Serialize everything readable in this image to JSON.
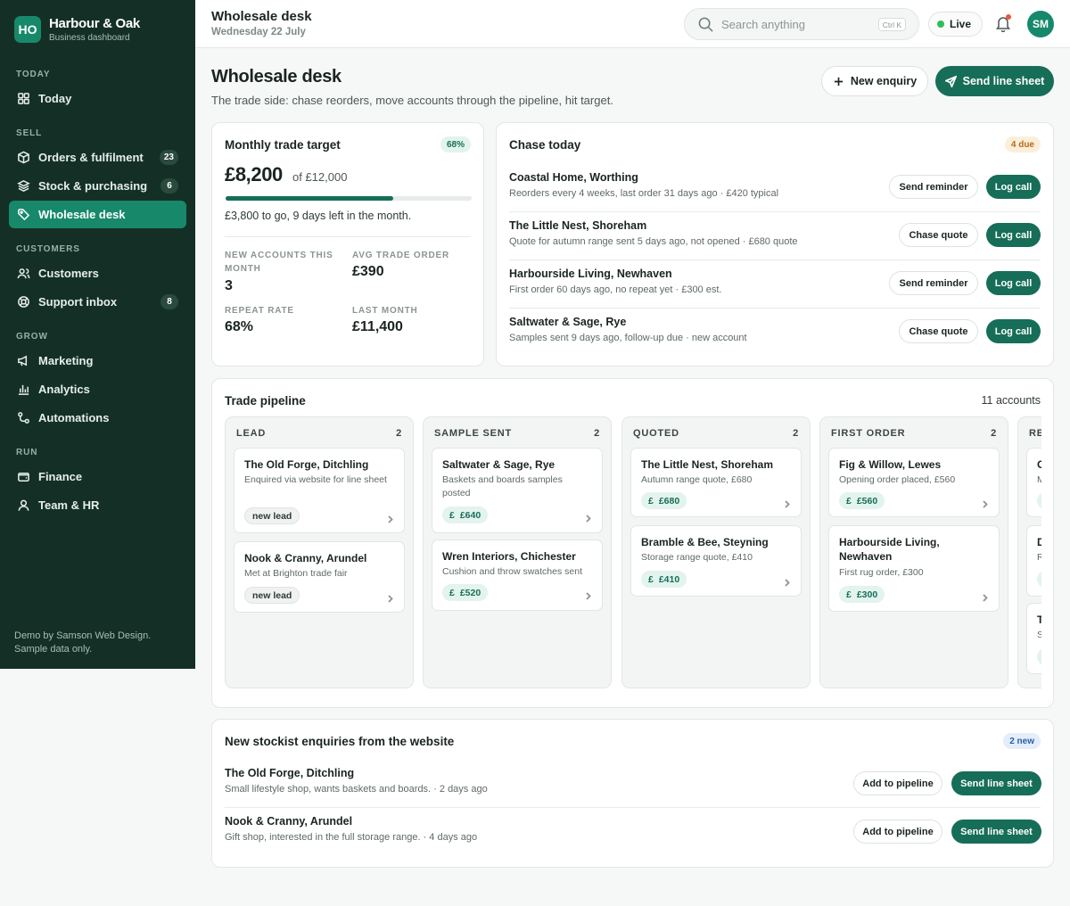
{
  "brand": {
    "initials": "HO",
    "name": "Harbour & Oak",
    "sub": "Business dashboard"
  },
  "nav": {
    "today_section": "TODAY",
    "today": "Today",
    "sell_section": "SELL",
    "orders": "Orders & fulfilment",
    "orders_badge": "23",
    "stock": "Stock & purchasing",
    "stock_badge": "6",
    "wholesale": "Wholesale desk",
    "customers_section": "CUSTOMERS",
    "customers": "Customers",
    "support": "Support inbox",
    "support_badge": "8",
    "grow_section": "GROW",
    "marketing": "Marketing",
    "analytics": "Analytics",
    "automations": "Automations",
    "run_section": "RUN",
    "finance": "Finance",
    "team": "Team & HR"
  },
  "footer": {
    "line1": "Demo by Samson Web Design.",
    "line2": "Sample data only."
  },
  "topbar": {
    "title": "Wholesale desk",
    "date": "Wednesday 22 July",
    "search_placeholder": "Search anything",
    "shortcut": "Ctrl K",
    "live": "Live",
    "avatar": "SM"
  },
  "page": {
    "title": "Wholesale desk",
    "subtitle": "The trade side: chase reorders, move accounts through the pipeline, hit target.",
    "new_enquiry": "New enquiry",
    "send_line_sheet": "Send line sheet"
  },
  "target": {
    "title": "Monthly trade target",
    "pct": "68%",
    "progress": 0.68,
    "amount": "£8,200",
    "of": "of £12,000",
    "togo": "£3,800 to go, 9 days left in the month.",
    "stats": [
      {
        "label": "NEW ACCOUNTS THIS MONTH",
        "value": "3"
      },
      {
        "label": "AVG TRADE ORDER",
        "value": "£390"
      },
      {
        "label": "REPEAT RATE",
        "value": "68%"
      },
      {
        "label": "LAST MONTH",
        "value": "£11,400"
      }
    ]
  },
  "chase": {
    "title": "Chase today",
    "due": "4 due",
    "rows": [
      {
        "name": "Coastal Home, Worthing",
        "desc": "Reorders every 4 weeks, last order 31 days ago · £420 typical",
        "action": "Send reminder",
        "log": "Log call"
      },
      {
        "name": "The Little Nest, Shoreham",
        "desc": "Quote for autumn range sent 5 days ago, not opened · £680 quote",
        "action": "Chase quote",
        "log": "Log call"
      },
      {
        "name": "Harbourside Living, Newhaven",
        "desc": "First order 60 days ago, no repeat yet · £300 est.",
        "action": "Send reminder",
        "log": "Log call"
      },
      {
        "name": "Saltwater & Sage, Rye",
        "desc": "Samples sent 9 days ago, follow-up due · new account",
        "action": "Chase quote",
        "log": "Log call"
      }
    ]
  },
  "pipeline": {
    "title": "Trade pipeline",
    "count": "11 accounts",
    "columns": [
      {
        "name": "LEAD",
        "count": "2",
        "deals": [
          {
            "name": "The Old Forge, Ditchling",
            "desc": "Enquired via website for line sheet",
            "tag": "new lead"
          },
          {
            "name": "Nook & Cranny, Arundel",
            "desc": "Met at Brighton trade fair",
            "tag": "new lead"
          }
        ]
      },
      {
        "name": "SAMPLE SENT",
        "count": "2",
        "deals": [
          {
            "name": "Saltwater & Sage, Rye",
            "desc": "Baskets and boards samples posted",
            "tag": "£640"
          },
          {
            "name": "Wren Interiors, Chichester",
            "desc": "Cushion and throw swatches sent",
            "tag": "£520"
          }
        ]
      },
      {
        "name": "QUOTED",
        "count": "2",
        "deals": [
          {
            "name": "The Little Nest, Shoreham",
            "desc": "Autumn range quote, £680",
            "tag": "£680"
          },
          {
            "name": "Bramble & Bee, Steyning",
            "desc": "Storage range quote, £410",
            "tag": "£410"
          }
        ]
      },
      {
        "name": "FIRST ORDER",
        "count": "2",
        "deals": [
          {
            "name": "Fig & Willow, Lewes",
            "desc": "Opening order placed, £560",
            "tag": "£560"
          },
          {
            "name": "Harbourside Living, Newhaven",
            "desc": "First rug order, £300",
            "tag": "£300"
          }
        ]
      },
      {
        "name": "RE",
        "count": "",
        "deals": [
          {
            "name": "C",
            "desc": "M",
            "tag": ""
          },
          {
            "name": "D",
            "desc": "R",
            "tag": ""
          },
          {
            "name": "T",
            "desc": "S",
            "tag": ""
          }
        ]
      }
    ]
  },
  "enquiries": {
    "title": "New stockist enquiries from the website",
    "badge": "2 new",
    "rows": [
      {
        "name": "The Old Forge, Ditchling",
        "desc": "Small lifestyle shop, wants baskets and boards. · 2 days ago",
        "add": "Add to pipeline",
        "send": "Send line sheet"
      },
      {
        "name": "Nook & Cranny, Arundel",
        "desc": "Gift shop, interested in the full storage range. · 4 days ago",
        "add": "Add to pipeline",
        "send": "Send line sheet"
      }
    ]
  }
}
